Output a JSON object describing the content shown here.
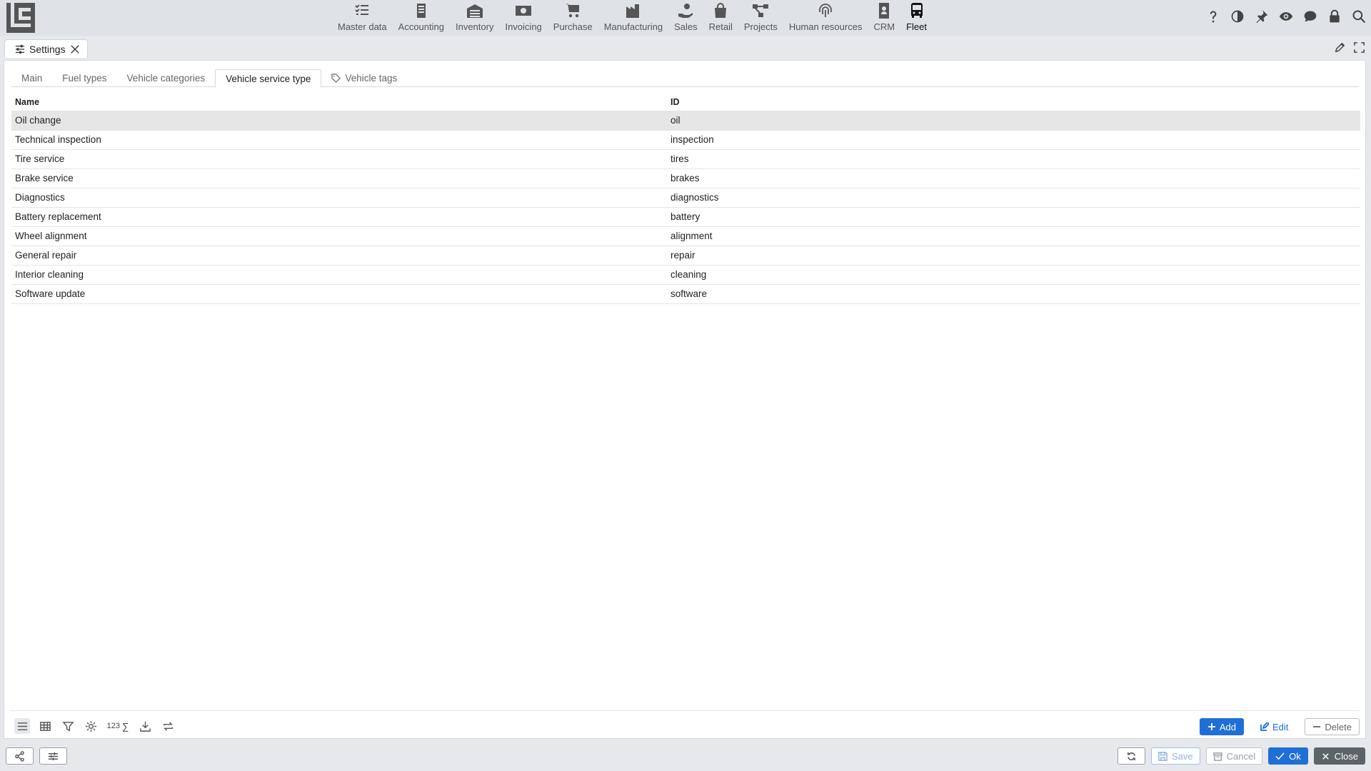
{
  "nav": {
    "modules": [
      {
        "label": "Master data",
        "icon": "checklist-icon"
      },
      {
        "label": "Accounting",
        "icon": "ledger-icon"
      },
      {
        "label": "Inventory",
        "icon": "warehouse-icon"
      },
      {
        "label": "Invoicing",
        "icon": "cash-icon"
      },
      {
        "label": "Purchase",
        "icon": "cart-icon"
      },
      {
        "label": "Manufacturing",
        "icon": "factory-icon"
      },
      {
        "label": "Sales",
        "icon": "hand-coin-icon"
      },
      {
        "label": "Retail",
        "icon": "shopping-bag-icon"
      },
      {
        "label": "Projects",
        "icon": "project-diagram-icon"
      },
      {
        "label": "Human resources",
        "icon": "fingerprint-icon"
      },
      {
        "label": "CRM",
        "icon": "contact-card-icon"
      },
      {
        "label": "Fleet",
        "icon": "bus-icon",
        "active": true
      }
    ],
    "right_icons": [
      "help-icon",
      "contrast-icon",
      "pin-icon",
      "eye-icon",
      "chat-icon",
      "lock-icon",
      "search-icon"
    ]
  },
  "window_tab": {
    "label": "Settings"
  },
  "subtabs": [
    {
      "label": "Main"
    },
    {
      "label": "Fuel types"
    },
    {
      "label": "Vehicle categories"
    },
    {
      "label": "Vehicle service type",
      "active": true
    },
    {
      "label": "Vehicle tags",
      "icon": "tag-icon"
    }
  ],
  "table": {
    "headers": {
      "name": "Name",
      "id": "ID"
    },
    "rows": [
      {
        "name": "Oil change",
        "id": "oil",
        "selected": true
      },
      {
        "name": "Technical inspection",
        "id": "inspection"
      },
      {
        "name": "Tire service",
        "id": "tires"
      },
      {
        "name": "Brake service",
        "id": "brakes"
      },
      {
        "name": "Diagnostics",
        "id": "diagnostics"
      },
      {
        "name": "Battery replacement",
        "id": "battery"
      },
      {
        "name": "Wheel alignment",
        "id": "alignment"
      },
      {
        "name": "General repair",
        "id": "repair"
      },
      {
        "name": "Interior cleaning",
        "id": "cleaning"
      },
      {
        "name": "Software update",
        "id": "software"
      }
    ]
  },
  "list_toolbar": {
    "counter_label": "123",
    "sum_label": "∑"
  },
  "actions": {
    "add": "Add",
    "edit": "Edit",
    "delete": "Delete"
  },
  "bottom": {
    "save": "Save",
    "cancel": "Cancel",
    "ok": "Ok",
    "close": "Close"
  },
  "colors": {
    "accent": "#1f6fd6",
    "close_button": "#5c636a",
    "selected_row": "#e6e6e6"
  }
}
